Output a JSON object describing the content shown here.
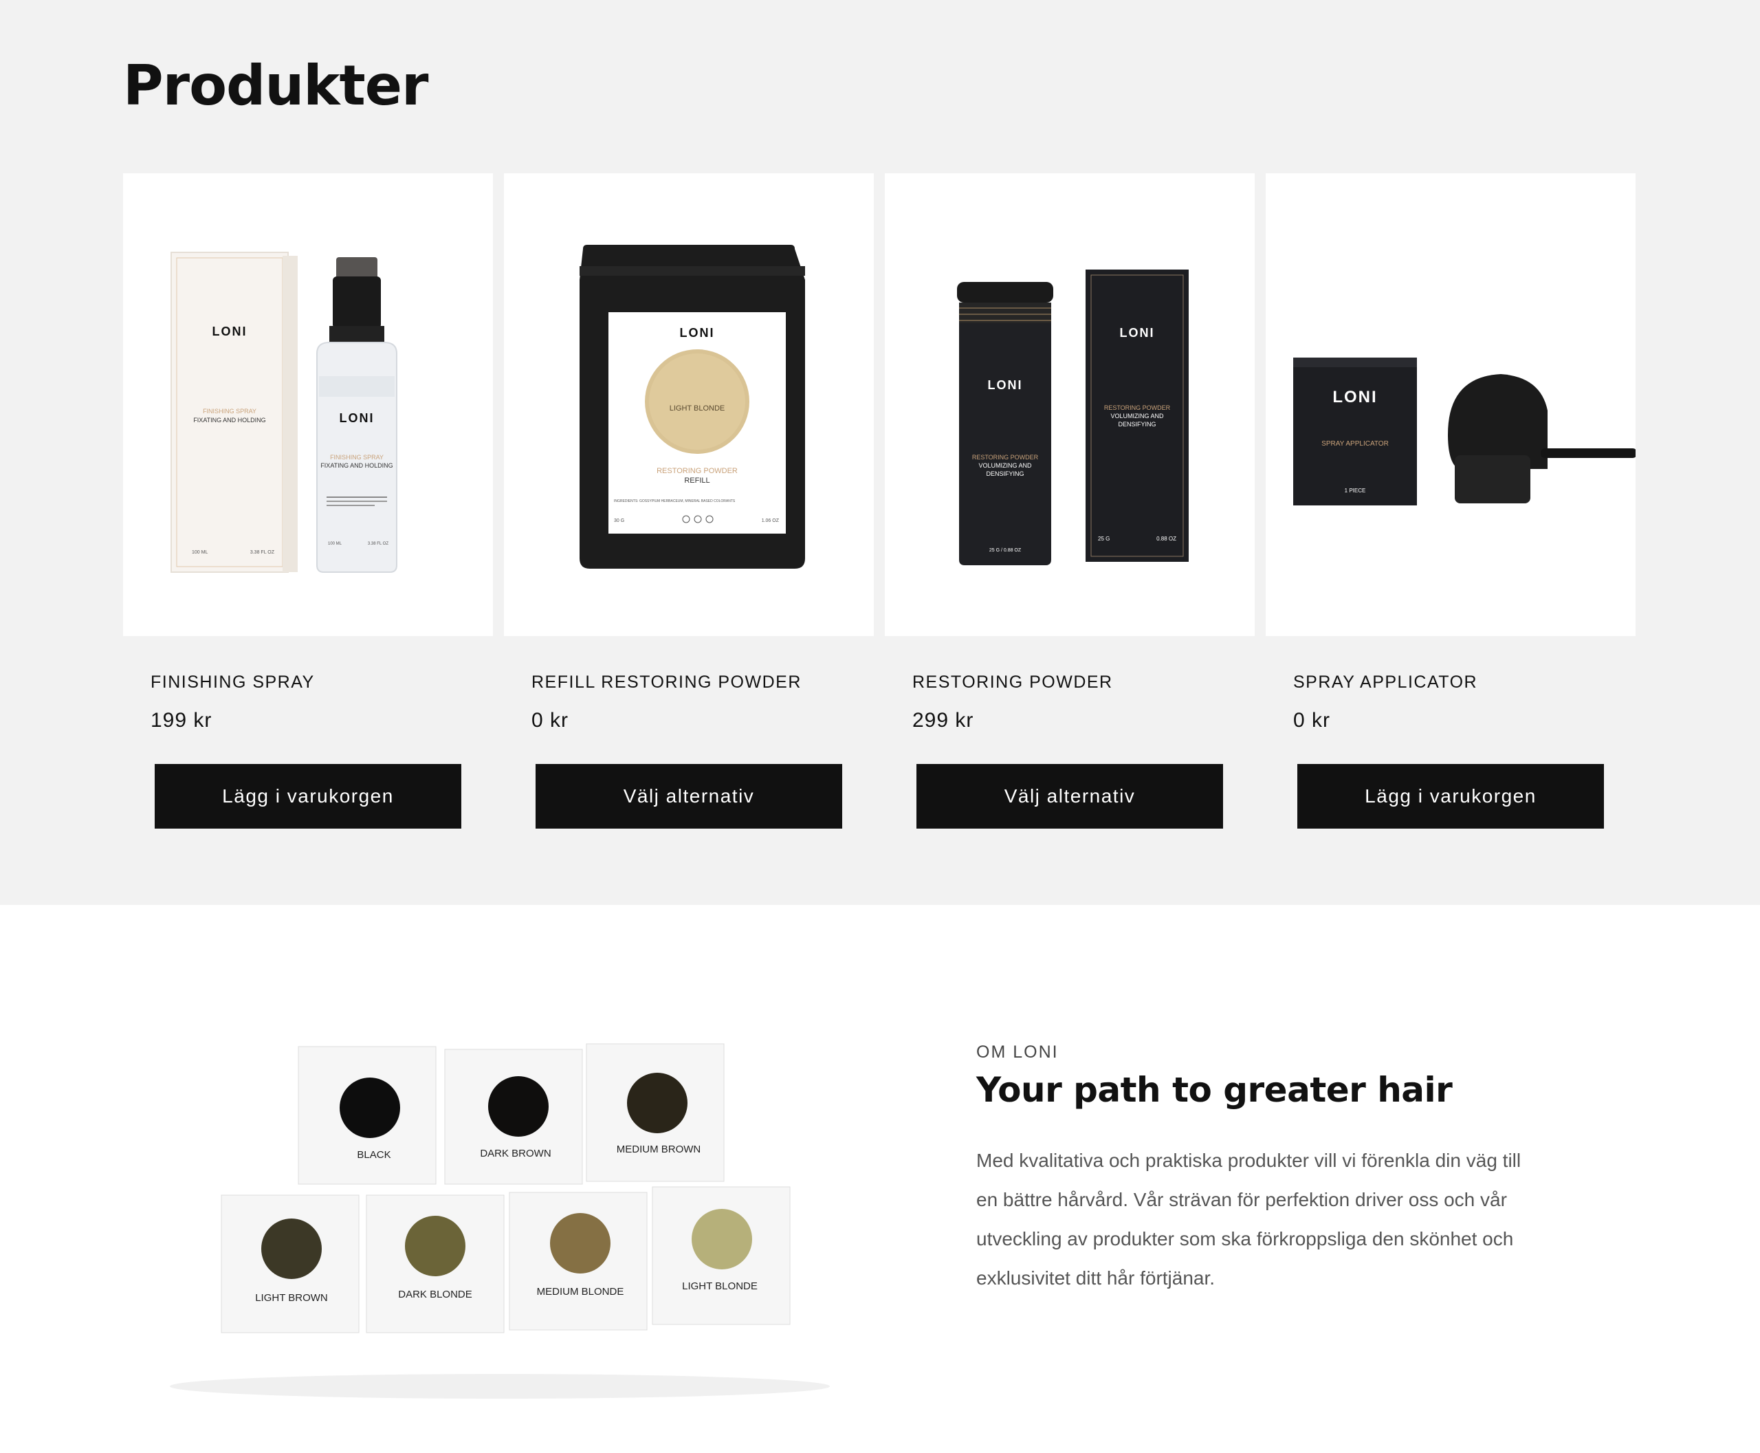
{
  "products": {
    "title": "Produkter",
    "items": [
      {
        "name": "FINISHING SPRAY",
        "price": "199 kr",
        "button": "Lägg i varukorgen",
        "image_text": {
          "brand": "LONI",
          "box_line1": "FINISHING SPRAY",
          "box_line2": "FIXATING AND HOLDING",
          "box_ml": "100 ML",
          "box_oz": "3.38 FL OZ",
          "bottle_line1": "FINISHING SPRAY",
          "bottle_line2": "FIXATING AND HOLDING",
          "bottle_ml": "100 ML",
          "bottle_oz": "3.38 FL OZ"
        }
      },
      {
        "name": "REFILL RESTORING POWDER",
        "price": "0 kr",
        "button": "Välj alternativ",
        "image_text": {
          "brand": "LONI",
          "shade": "LIGHT BLONDE",
          "line1": "RESTORING POWDER",
          "line2": "REFILL",
          "ingredients": "INGREDIENTS: GOSSYPIUM HERBACEUM, MINERAL BASED COLORANTS",
          "grams": "30 G",
          "ounces": "1.06 OZ"
        }
      },
      {
        "name": "RESTORING POWDER",
        "price": "299 kr",
        "button": "Välj alternativ",
        "image_text": {
          "brand": "LONI",
          "line1": "RESTORING POWDER",
          "line2": "VOLUMIZING AND",
          "line3": "DENSIFYING",
          "can_weight": "25 G / 0.88 OZ",
          "box_grams": "25 G",
          "box_ounces": "0.88 OZ"
        }
      },
      {
        "name": "SPRAY APPLICATOR",
        "price": "0 kr",
        "button": "Lägg i varukorgen",
        "image_text": {
          "brand": "LONI",
          "line1": "SPRAY APPLICATOR",
          "pieces": "1 PIECE"
        }
      }
    ]
  },
  "about": {
    "eyebrow": "OM LONI",
    "heading": "Your path to greater hair",
    "body": "Med kvalitativa och praktiska produkter vill vi förenkla din väg till en bättre hårvård. Vår strävan för perfektion driver oss och vår utveckling av produkter som ska förkroppsliga den skönhet och exklusivitet ditt hår förtjänar.",
    "shades": [
      "BLACK",
      "DARK BROWN",
      "MEDIUM BROWN",
      "LIGHT BROWN",
      "DARK BLONDE",
      "MEDIUM BLONDE",
      "LIGHT BLONDE"
    ]
  },
  "colors": {
    "section_bg": "#f2f2f2",
    "button_bg": "#111111",
    "button_text": "#ffffff",
    "accent_gold": "#c9a27a"
  }
}
